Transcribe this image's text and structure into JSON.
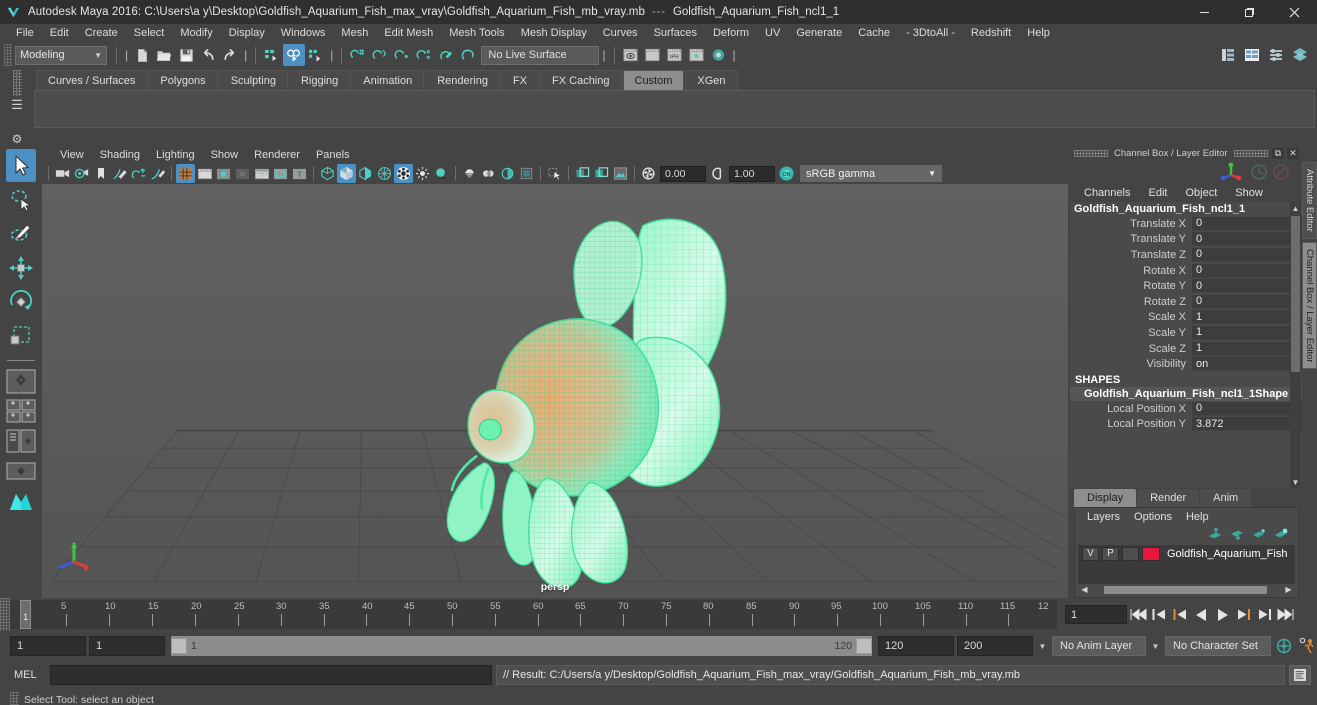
{
  "window": {
    "app_title": "Autodesk Maya 2016: C:\\Users\\a y\\Desktop\\Goldfish_Aquarium_Fish_max_vray\\Goldfish_Aquarium_Fish_mb_vray.mb",
    "title_separator": "---",
    "document_name": "Goldfish_Aquarium_Fish_ncl1_1",
    "minimize": "─",
    "maximize": "❐",
    "close": "✕"
  },
  "menubar": {
    "items": [
      "File",
      "Edit",
      "Create",
      "Select",
      "Modify",
      "Display",
      "Windows",
      "Mesh",
      "Edit Mesh",
      "Mesh Tools",
      "Mesh Display",
      "Curves",
      "Surfaces",
      "Deform",
      "UV",
      "Generate",
      "Cache",
      "- 3DtoAll -",
      "Redshift",
      "Help"
    ]
  },
  "statusline": {
    "mode": "Modeling",
    "live_surface": "No Live Surface",
    "icons": [
      "new-scene-icon",
      "open-scene-icon",
      "save-scene-icon",
      "undo-icon",
      "redo-icon",
      "select-by-hierarchy-icon",
      "select-by-object-icon",
      "select-by-component-icon",
      "snap-to-grid-icon",
      "snap-to-curve-icon",
      "snap-to-point-icon",
      "snap-to-projected-center-icon",
      "snap-to-view-plane-icon",
      "make-live-icon",
      "render-view-icon",
      "render-sequence-icon",
      "ipr-render-icon",
      "render-settings-icon",
      "hypershade-icon"
    ],
    "right_icons": [
      "show-hide-modeling-toolkit-icon",
      "show-hide-attribute-editor-icon",
      "show-hide-tool-settings-icon",
      "show-hide-channel-box-icon"
    ]
  },
  "shelf": {
    "tabs": [
      "Curves / Surfaces",
      "Polygons",
      "Sculpting",
      "Rigging",
      "Animation",
      "Rendering",
      "FX",
      "FX Caching",
      "Custom",
      "XGen"
    ],
    "active_tab": "Custom"
  },
  "toolbox": {
    "tools": [
      {
        "name": "select-tool",
        "selected": true
      },
      {
        "name": "lasso-select-tool",
        "selected": false
      },
      {
        "name": "paint-select-tool",
        "selected": false
      },
      {
        "name": "move-tool",
        "selected": false
      },
      {
        "name": "rotate-tool",
        "selected": false
      },
      {
        "name": "scale-tool",
        "selected": false
      }
    ],
    "layouts": [
      "single-perspective-layout",
      "four-view-layout",
      "persp-outliner-layout",
      "persp-graph-layout",
      "hypershade-layout"
    ]
  },
  "viewport": {
    "menus": [
      "View",
      "Shading",
      "Lighting",
      "Show",
      "Renderer",
      "Panels"
    ],
    "exposure": "0.00",
    "gamma_value": "1.00",
    "color_management": "sRGB gamma",
    "camera_label": "persp",
    "toolbar_icons": [
      "select-camera-icon",
      "camera-attributes-icon",
      "bookmark-icon",
      "image-plane-icon",
      "two-d-pan-zoom-icon",
      "grease-pencil-icon",
      "grid-toggle-icon",
      "film-gate-icon",
      "resolution-gate-icon",
      "gate-mask-icon",
      "film-origin-icon",
      "safe-action-icon",
      "title-safe-icon",
      "wireframe-shading-icon",
      "smooth-shade-all-icon",
      "smooth-shade-selected-icon",
      "flat-shade-icon",
      "shade-wireframe-icon",
      "lighting-icon",
      "shadows-icon",
      "default-light-icon",
      "two-sided-lighting-icon",
      "xray-icon",
      "xray-joints-icon",
      "isolate-select-icon",
      "paint-effects-icon",
      "texture-mode-icon",
      "hardware-texturing-icon"
    ],
    "gizmo": {
      "x_axis_color": "#e03b3b",
      "y_axis_color": "#3fc63f",
      "z_axis_color": "#3b5ce0"
    },
    "model": {
      "name": "goldfish-mesh",
      "selection_color": "#5cffb0",
      "texture_tint": "#d9863a"
    }
  },
  "channelbox": {
    "panel_title": "Channel Box / Layer Editor",
    "menus": [
      "Channels",
      "Edit",
      "Object",
      "Show"
    ],
    "object_name": "Goldfish_Aquarium_Fish_ncl1_1",
    "transform_attributes": [
      {
        "label": "Translate X",
        "value": "0"
      },
      {
        "label": "Translate Y",
        "value": "0"
      },
      {
        "label": "Translate Z",
        "value": "0"
      },
      {
        "label": "Rotate X",
        "value": "0"
      },
      {
        "label": "Rotate Y",
        "value": "0"
      },
      {
        "label": "Rotate Z",
        "value": "0"
      },
      {
        "label": "Scale X",
        "value": "1"
      },
      {
        "label": "Scale Y",
        "value": "1"
      },
      {
        "label": "Scale Z",
        "value": "1"
      },
      {
        "label": "Visibility",
        "value": "on"
      }
    ],
    "shapes_header": "SHAPES",
    "shape_name": "Goldfish_Aquarium_Fish_ncl1_1Shape",
    "shape_attributes": [
      {
        "label": "Local Position X",
        "value": "0"
      },
      {
        "label": "Local Position Y",
        "value": "3.872"
      }
    ]
  },
  "layereditor": {
    "tabs": [
      "Display",
      "Render",
      "Anim"
    ],
    "active_tab": "Display",
    "menus": [
      "Layers",
      "Options",
      "Help"
    ],
    "toolbar_icons": [
      "move-layer-up-icon",
      "move-layer-down-icon",
      "new-layer-icon",
      "new-layer-from-selected-icon"
    ],
    "layers": [
      {
        "visibility": "V",
        "playback": "P",
        "type": "",
        "color": "#e8183c",
        "name": "Goldfish_Aquarium_Fish"
      }
    ]
  },
  "dock": {
    "tabs": [
      "Attribute Editor",
      "Channel Box / Layer Editor"
    ],
    "active_tab": "Channel Box / Layer Editor"
  },
  "timeslider": {
    "tick_labels": [
      "5",
      "10",
      "15",
      "20",
      "25",
      "30",
      "35",
      "40",
      "45",
      "50",
      "55",
      "60",
      "65",
      "70",
      "75",
      "80",
      "85",
      "90",
      "95",
      "100",
      "105",
      "110",
      "115",
      "12"
    ],
    "current_frame": "1",
    "current_frame_field": "1",
    "playback_icons": [
      "go-to-start-icon",
      "step-back-keyframe-icon",
      "step-back-frame-icon",
      "play-backwards-icon",
      "play-forwards-icon",
      "step-forward-frame-icon",
      "step-forward-keyframe-icon",
      "go-to-end-icon"
    ]
  },
  "rangeslider": {
    "anim_start": "1",
    "range_start": "1",
    "bar_start_label": "1",
    "bar_end_label": "120",
    "range_end": "120",
    "anim_end": "200",
    "anim_layer": "No Anim Layer",
    "character_set": "No Character Set",
    "right_icons": [
      "auto-keyframe-icon",
      "animation-preferences-icon"
    ]
  },
  "commandline": {
    "language_label": "MEL",
    "input_value": "",
    "result_text": "// Result: C:/Users/a y/Desktop/Goldfish_Aquarium_Fish_max_vray/Goldfish_Aquarium_Fish_mb_vray.mb",
    "script_editor_icon": "script-editor-icon"
  },
  "helpline": {
    "text": "Select Tool: select an object"
  },
  "colors": {
    "accent_blue": "#4c90c4",
    "panel_bg": "#444444",
    "viewport_bg": "#5a5a5a",
    "field_bg": "#2e2e2e",
    "teal_icon": "#4dd0c4",
    "layer_red": "#e8183c"
  }
}
